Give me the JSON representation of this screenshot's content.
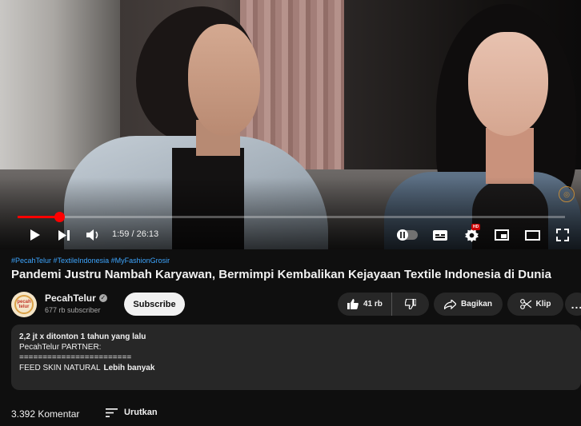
{
  "player": {
    "time_display": "1:59 / 26:13",
    "progress_fraction": 0.076,
    "autoplay_on": false
  },
  "video": {
    "hashtags": "#PecahTelur #TextileIndonesia #MyFashionGrosir",
    "title": "Pandemi Justru Nambah Karyawan, Bermimpi Kembalikan Kejayaan Textile Indonesia di Dunia"
  },
  "channel": {
    "name": "PecahTelur",
    "avatar_text": "pecah telur",
    "subscribers": "677 rb subscriber",
    "subscribe_label": "Subscribe"
  },
  "actions": {
    "likes": "41 rb",
    "share_label": "Bagikan",
    "clip_label": "Klip",
    "more_label": "..."
  },
  "description": {
    "stats": "2,2 jt x ditonton  1 tahun yang lalu",
    "line1": "PecahTelur PARTNER:",
    "line2": "========================",
    "line3": "FEED SKIN NATURAL",
    "more_label": "Lebih banyak"
  },
  "comments": {
    "count_label": "3.392 Komentar",
    "sort_label": "Urutkan"
  },
  "colors": {
    "background": "#0f0f0f",
    "progress": "#ff0000",
    "hashtag": "#3ea6ff",
    "pill": "#272727"
  }
}
